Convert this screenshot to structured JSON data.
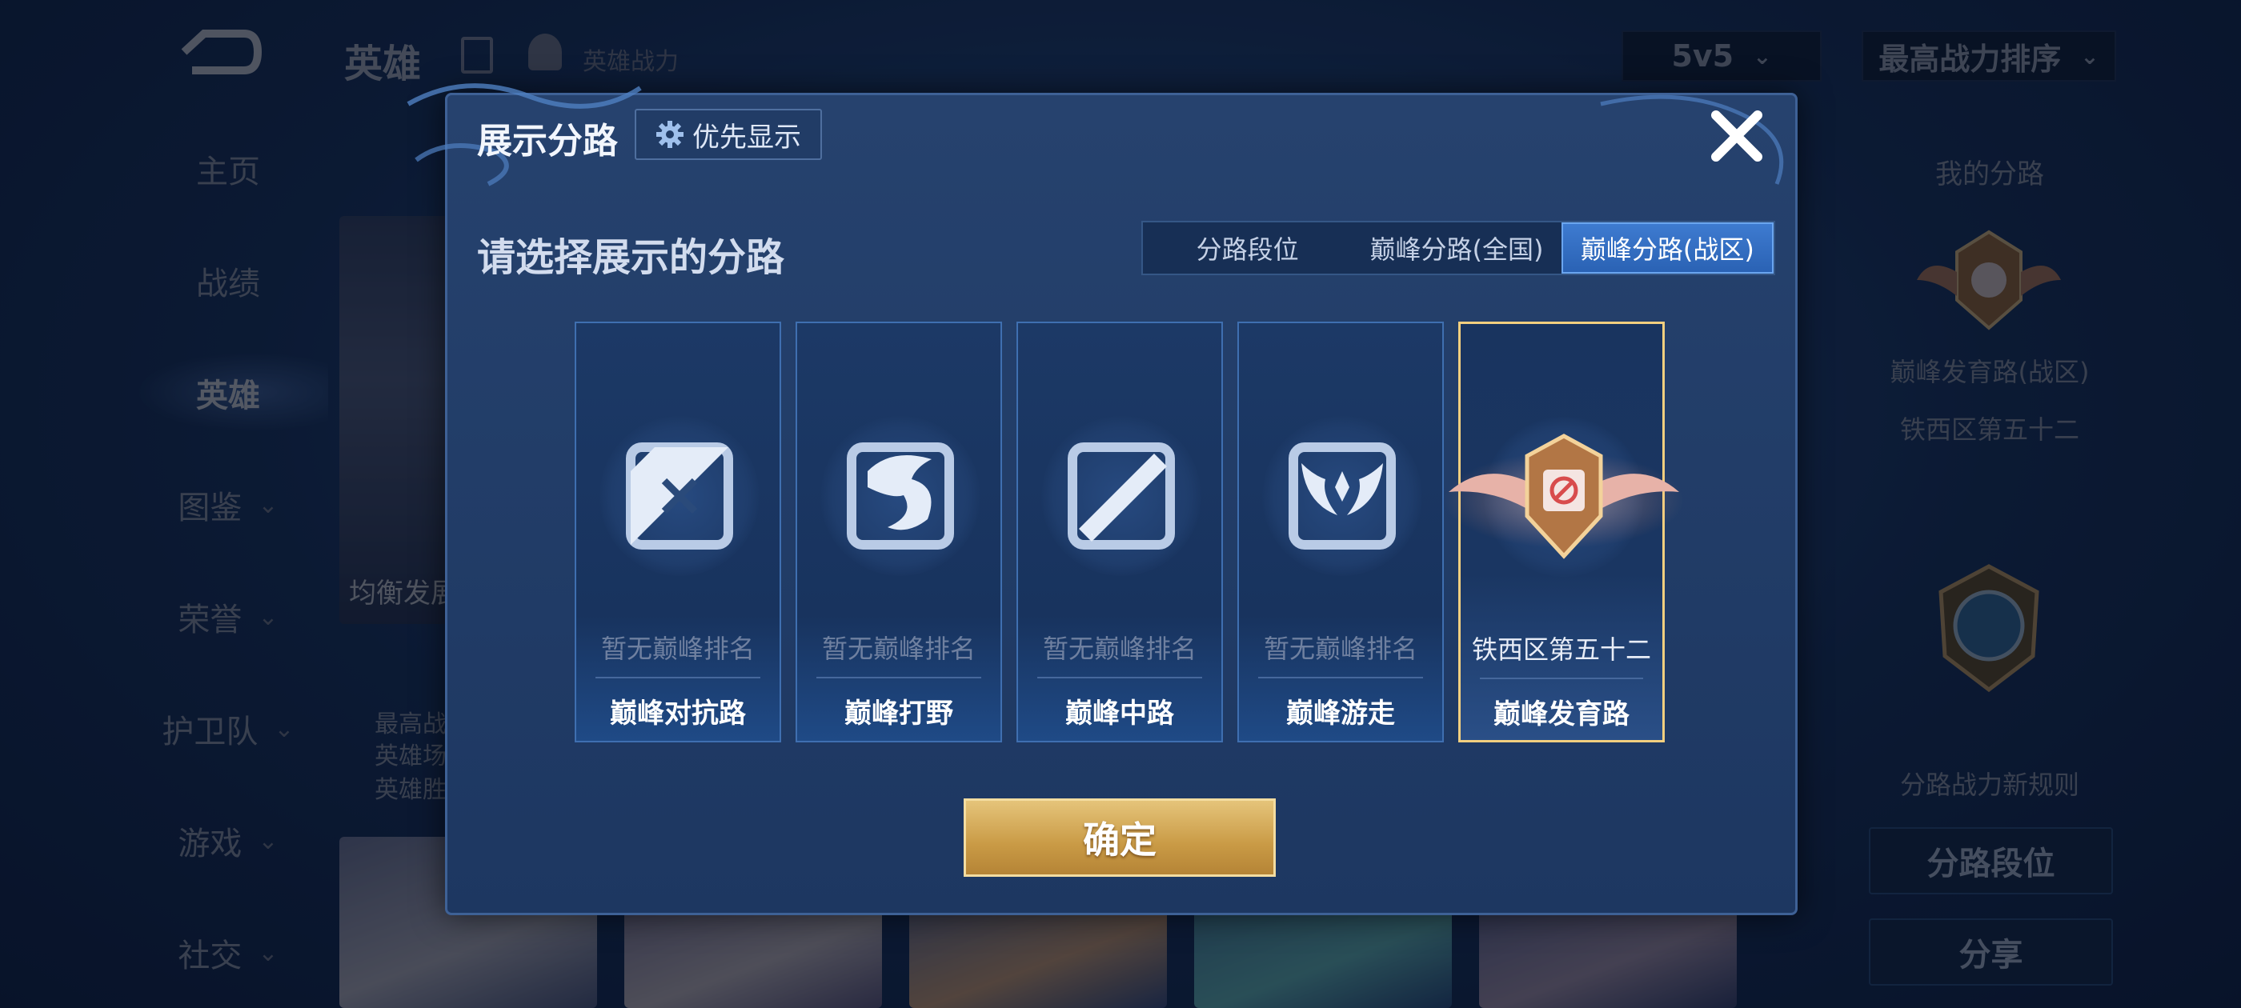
{
  "header": {
    "title": "英雄",
    "subtitle": "英雄战力",
    "mode_select": "5v5",
    "sort_select": "最高战力排序"
  },
  "nav": [
    {
      "label": "主页",
      "has_chevron": false
    },
    {
      "label": "战绩",
      "has_chevron": false
    },
    {
      "label": "英雄",
      "has_chevron": false,
      "active": true
    },
    {
      "label": "图鉴",
      "has_chevron": true
    },
    {
      "label": "荣誉",
      "has_chevron": true
    },
    {
      "label": "护卫队",
      "has_chevron": true
    },
    {
      "label": "游戏",
      "has_chevron": true
    },
    {
      "label": "社交",
      "has_chevron": true
    }
  ],
  "hero_card": {
    "tag": "均衡发展",
    "lines": [
      "最高战",
      "英雄场",
      "英雄胜"
    ]
  },
  "right_panel": {
    "title": "我的分路",
    "lane_label": "巅峰发育路(战区)",
    "rank": "铁西区第五十二",
    "rule_text": "分路战力新规则",
    "lane_rank_button": "分路段位",
    "share_button": "分享"
  },
  "modal": {
    "title": "展示分路",
    "priority_button": "优先显示",
    "prompt": "请选择展示的分路",
    "tabs": [
      {
        "label": "分路段位",
        "active": false
      },
      {
        "label": "巅峰分路(全国)",
        "active": false
      },
      {
        "label": "巅峰分路(战区)",
        "active": true
      }
    ],
    "lanes": [
      {
        "name": "巅峰对抗路",
        "rank": "暂无巅峰排名",
        "icon": "clash-lane-icon",
        "selected": false
      },
      {
        "name": "巅峰打野",
        "rank": "暂无巅峰排名",
        "icon": "jungle-dragon-icon",
        "selected": false
      },
      {
        "name": "巅峰中路",
        "rank": "暂无巅峰排名",
        "icon": "mid-lane-icon",
        "selected": false
      },
      {
        "name": "巅峰游走",
        "rank": "暂无巅峰排名",
        "icon": "roam-wings-icon",
        "selected": false
      },
      {
        "name": "巅峰发育路",
        "rank": "铁西区第五十二",
        "icon": "farm-lane-badge-icon",
        "selected": true
      }
    ],
    "confirm_button": "确定"
  },
  "colors": {
    "accent_gold": "#f3cf7f",
    "tab_active": "#3e7bd0",
    "modal_bg": "#26426e"
  }
}
